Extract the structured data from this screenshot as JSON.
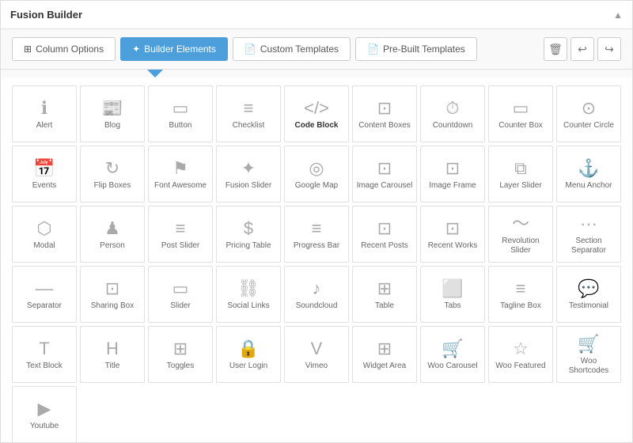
{
  "titleBar": {
    "title": "Fusion Builder",
    "collapseIcon": "▲"
  },
  "toolbar": {
    "tabs": [
      {
        "id": "column-options",
        "label": "Column Options",
        "icon": "⊞",
        "active": false
      },
      {
        "id": "builder-elements",
        "label": "Builder Elements",
        "icon": "✦",
        "active": true
      },
      {
        "id": "custom-templates",
        "label": "Custom Templates",
        "icon": "📄",
        "active": false
      },
      {
        "id": "pre-built-templates",
        "label": "Pre-Built Templates",
        "icon": "📄",
        "active": false
      }
    ],
    "deleteIcon": "🗑",
    "undoIcon": "↩",
    "redoIcon": "↪"
  },
  "elements": [
    {
      "id": "alert",
      "label": "Alert",
      "icon": "ℹ",
      "bold": false
    },
    {
      "id": "blog",
      "label": "Blog",
      "icon": "📰",
      "bold": false
    },
    {
      "id": "button",
      "label": "Button",
      "icon": "▭",
      "bold": false
    },
    {
      "id": "checklist",
      "label": "Checklist",
      "icon": "☰",
      "bold": false
    },
    {
      "id": "code-block",
      "label": "Code Block",
      "icon": "&lt;/&gt;",
      "bold": true
    },
    {
      "id": "content-boxes",
      "label": "Content Boxes",
      "icon": "⊡",
      "bold": false
    },
    {
      "id": "countdown",
      "label": "Countdown",
      "icon": "⏰",
      "bold": false
    },
    {
      "id": "counter-box",
      "label": "Counter Box",
      "icon": "▭",
      "bold": false
    },
    {
      "id": "counter-circle",
      "label": "Counter Circle",
      "icon": "⏱",
      "bold": false
    },
    {
      "id": "events",
      "label": "Events",
      "icon": "📅",
      "bold": false
    },
    {
      "id": "flip-boxes",
      "label": "Flip Boxes",
      "icon": "↻",
      "bold": false
    },
    {
      "id": "font-awesome",
      "label": "Font Awesome",
      "icon": "⚑",
      "bold": false
    },
    {
      "id": "fusion-slider",
      "label": "Fusion Slider",
      "icon": "✿",
      "bold": false
    },
    {
      "id": "google-map",
      "label": "Google Map",
      "icon": "📍",
      "bold": false
    },
    {
      "id": "image-carousel",
      "label": "Image Carousel",
      "icon": "🖼",
      "bold": false
    },
    {
      "id": "image-frame",
      "label": "Image Frame",
      "icon": "🖼",
      "bold": false
    },
    {
      "id": "layer-slider",
      "label": "Layer Slider",
      "icon": "⧉",
      "bold": false
    },
    {
      "id": "menu-anchor",
      "label": "Menu Anchor",
      "icon": "⚓",
      "bold": false
    },
    {
      "id": "modal",
      "label": "Modal",
      "icon": "⬡",
      "bold": false
    },
    {
      "id": "person",
      "label": "Person",
      "icon": "👤",
      "bold": false
    },
    {
      "id": "post-slider",
      "label": "Post Slider",
      "icon": "☰",
      "bold": false
    },
    {
      "id": "pricing-table",
      "label": "Pricing Table",
      "icon": "$",
      "bold": false
    },
    {
      "id": "progress-bar",
      "label": "Progress Bar",
      "icon": "≡",
      "bold": false
    },
    {
      "id": "recent-posts",
      "label": "Recent Posts",
      "icon": "🗒",
      "bold": false
    },
    {
      "id": "recent-works",
      "label": "Recent Works",
      "icon": "🖼",
      "bold": false
    },
    {
      "id": "revolution-slider",
      "label": "Revolution Slider",
      "icon": "〜",
      "bold": false
    },
    {
      "id": "section-separator",
      "label": "Section Separator",
      "icon": "···",
      "bold": false
    },
    {
      "id": "separator",
      "label": "Separator",
      "icon": "—",
      "bold": false
    },
    {
      "id": "sharing-box",
      "label": "Sharing Box",
      "icon": "⬡",
      "bold": false
    },
    {
      "id": "slider",
      "label": "Slider",
      "icon": "🖥",
      "bold": false
    },
    {
      "id": "social-links",
      "label": "Social Links",
      "icon": "🔗",
      "bold": false
    },
    {
      "id": "soundcloud",
      "label": "Soundcloud",
      "icon": "♪",
      "bold": false
    },
    {
      "id": "table",
      "label": "Table",
      "icon": "⊞",
      "bold": false
    },
    {
      "id": "tabs",
      "label": "Tabs",
      "icon": "⬜",
      "bold": false
    },
    {
      "id": "tagline-box",
      "label": "Tagline Box",
      "icon": "☰",
      "bold": false
    },
    {
      "id": "testimonial",
      "label": "Testimonial",
      "icon": "💬",
      "bold": false
    },
    {
      "id": "text-block",
      "label": "Text Block",
      "icon": "T",
      "bold": false
    },
    {
      "id": "title",
      "label": "Title",
      "icon": "H",
      "bold": false
    },
    {
      "id": "toggles",
      "label": "Toggles",
      "icon": "⊞",
      "bold": false
    },
    {
      "id": "user-login",
      "label": "User Login",
      "icon": "🔒",
      "bold": false
    },
    {
      "id": "vimeo",
      "label": "Vimeo",
      "icon": "V",
      "bold": false
    },
    {
      "id": "widget-area",
      "label": "Widget Area",
      "icon": "⊞",
      "bold": false
    },
    {
      "id": "woo-carousel",
      "label": "Woo Carousel",
      "icon": "🛒",
      "bold": false
    },
    {
      "id": "woo-featured",
      "label": "Woo Featured",
      "icon": "☆",
      "bold": false
    },
    {
      "id": "woo-shortcodes",
      "label": "Woo Shortcodes",
      "icon": "🛒",
      "bold": false
    },
    {
      "id": "youtube",
      "label": "Youtube",
      "icon": "▶",
      "bold": false
    }
  ],
  "icons": {
    "alert": "ℹ",
    "blog": "📰",
    "button": "⬜",
    "checklist": "≡",
    "code-block": "</> ",
    "content-boxes": "⊡",
    "countdown": "⊙",
    "counter-box": "▭",
    "counter-circle": "⊙",
    "events": "📅",
    "flip-boxes": "↻",
    "font-awesome": "⚑",
    "fusion-slider": "✿",
    "google-map": "◎",
    "image-carousel": "⊡",
    "image-frame": "⊡",
    "layer-slider": "⧉",
    "menu-anchor": "⚓",
    "modal": "⬡",
    "person": "♟",
    "post-slider": "≡",
    "pricing-table": "$",
    "progress-bar": "≡",
    "recent-posts": "⊡",
    "recent-works": "⊡",
    "revolution-slider": "〜",
    "section-separator": "···",
    "separator": "—",
    "sharing-box": "⊡",
    "slider": "▭",
    "social-links": "🔗",
    "soundcloud": "♪",
    "table": "⊞",
    "tabs": "⬜",
    "tagline-box": "≡",
    "testimonial": "💬",
    "text-block": "T",
    "title": "H",
    "toggles": "⊞",
    "user-login": "🔒",
    "vimeo": "V",
    "widget-area": "⊞",
    "woo-carousel": "🛒",
    "woo-featured": "☆",
    "woo-shortcodes": "🛒",
    "youtube": "▶"
  }
}
